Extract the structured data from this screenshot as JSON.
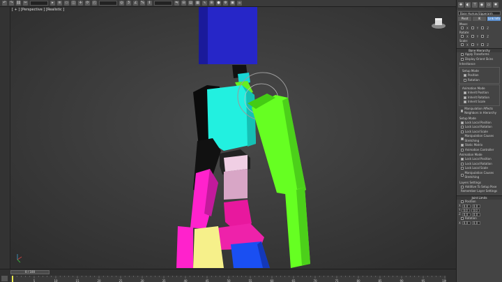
{
  "toolbar": {
    "icons": [
      "undo-icon",
      "redo-icon",
      "link-icon",
      "unlink-icon",
      "bind-icon",
      "select-icon",
      "select-name-icon",
      "region-icon",
      "window-crossing-icon",
      "move-icon",
      "rotate-icon",
      "scale-icon",
      "reference-icon",
      "pivot-icon",
      "snap-icon",
      "angle-snap-icon",
      "percent-snap-icon",
      "spinner-snap-icon",
      "named-selection-icon",
      "mirror-icon",
      "align-icon",
      "layer-icon",
      "graphite-icon",
      "curve-editor-icon",
      "schematic-icon",
      "material-editor-icon",
      "render-setup-icon",
      "render-frame-icon",
      "render-icon"
    ]
  },
  "viewport": {
    "label": "[ + ] [Perspective ] [Realistic ]"
  },
  "panel": {
    "object_name": "Base Human/Upperarm",
    "buttons": [
      "Pivot",
      "IK",
      "Link Info"
    ],
    "move_title": "Move:",
    "rotate_title": "Rotate:",
    "scale_title": "Scale:",
    "axes": [
      "X",
      "Y",
      "Z"
    ],
    "bone_hierarchy": "Bone Hierarchy",
    "apply_transforms": "Apply Transforms",
    "display_orient": "Display Orient Skins",
    "inheritance": "Inheritance",
    "setup_mode": "Setup Mode",
    "inh_position": "Position",
    "inh_rotation": "Rotation",
    "animation_mode": "Animation Mode",
    "inherit_position": "Inherit Position",
    "inherit_rotation": "Inherit Rotation",
    "inherit_scale": "Inherit Scale",
    "manip_affects": "Manipulation Affects Neighbors in Hierarchy",
    "setup_mode2": "Setup Mode",
    "lock_local_position": "Lock Local Position",
    "lock_local_rotation": "Lock Local Rotation",
    "lock_local_scale": "Lock Local Scale",
    "manip_stretching": "Manipulation Causes Stretching",
    "static_matrix": "Static Matrix",
    "animation_controller": "Animation Controller",
    "animation_mode2": "Animation Mode",
    "lock_local_position2": "Lock Local Position",
    "lock_local_rotation2": "Lock Local Rotation",
    "lock_local_scale2": "Lock Local Scale",
    "manip_stretching2": "Manipulation Causes Stretching",
    "layers_settings": "Layers Settings",
    "additive_pose": "Additive To Setup Pose",
    "remember_layer": "Remember Layer Settings",
    "joint_limits": "Joint Limits",
    "jl_position": "Position",
    "jl_rotation": "Rotation",
    "spin_value": "0.0"
  },
  "timeline": {
    "slider_text": "0 / 100",
    "ticks": [
      "0",
      "5",
      "10",
      "15",
      "20",
      "25",
      "30",
      "35",
      "40",
      "45",
      "50",
      "55",
      "60",
      "65",
      "70",
      "75",
      "80",
      "85",
      "90",
      "95",
      "100"
    ]
  }
}
